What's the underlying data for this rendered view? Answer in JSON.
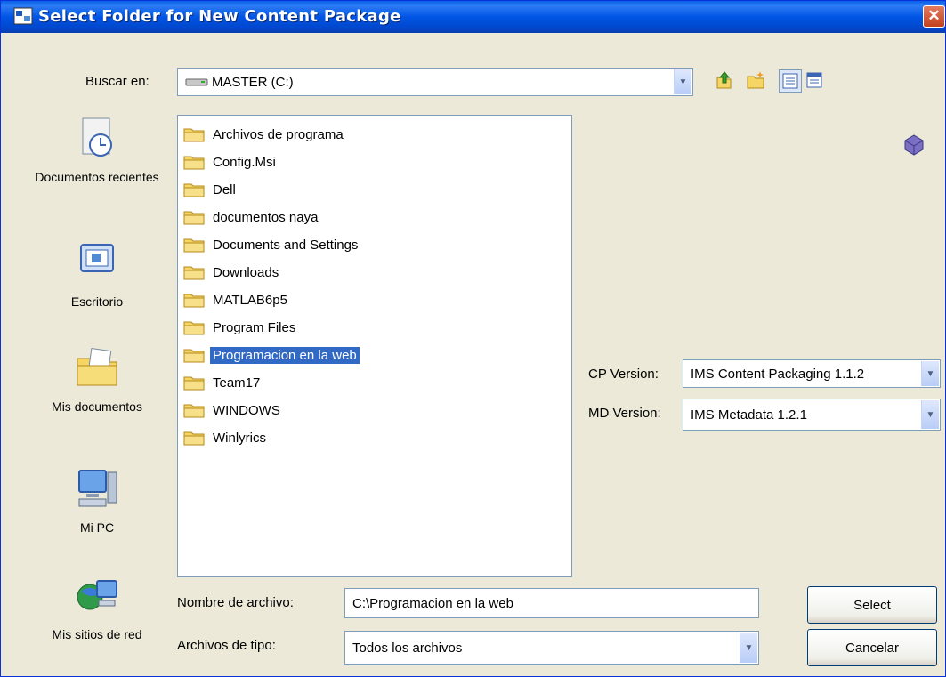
{
  "window": {
    "title": "Select Folder for New Content Package",
    "close_glyph": "✕"
  },
  "lookin": {
    "label": "Buscar en:",
    "value": "MASTER (C:)",
    "drive_icon": "drive-icon"
  },
  "toolbar": {
    "icons": [
      "up-folder-icon",
      "new-folder-icon",
      "list-view-icon",
      "details-view-icon"
    ]
  },
  "places": [
    {
      "label": "Documentos recientes",
      "icon": "recent-documents-icon"
    },
    {
      "label": "Escritorio",
      "icon": "desktop-icon"
    },
    {
      "label": "Mis documentos",
      "icon": "my-documents-icon"
    },
    {
      "label": "Mi PC",
      "icon": "my-computer-icon"
    },
    {
      "label": "Mis sitios de red",
      "icon": "network-places-icon"
    }
  ],
  "files": [
    {
      "name": "Archivos de programa"
    },
    {
      "name": "Config.Msi"
    },
    {
      "name": "Dell"
    },
    {
      "name": "documentos naya"
    },
    {
      "name": "Documents and Settings"
    },
    {
      "name": "Downloads"
    },
    {
      "name": "MATLAB6p5"
    },
    {
      "name": "Program Files"
    },
    {
      "name": "Programacion en la web",
      "selected": true
    },
    {
      "name": "Team17"
    },
    {
      "name": "WINDOWS"
    },
    {
      "name": "Winlyrics"
    }
  ],
  "options": {
    "cp_label": "CP Version:",
    "cp_value": "IMS Content Packaging 1.1.2",
    "md_label": "MD Version:",
    "md_value": "IMS Metadata 1.2.1"
  },
  "filename": {
    "label": "Nombre de archivo:",
    "value": "C:\\Programacion en la web"
  },
  "filetype": {
    "label": "Archivos de tipo:",
    "value": "Todos los archivos"
  },
  "buttons": {
    "select": "Select",
    "cancel": "Cancelar"
  },
  "colors": {
    "titlebar": "#0055e5",
    "selection": "#316ac5",
    "dialog_bg": "#ece9d8"
  }
}
